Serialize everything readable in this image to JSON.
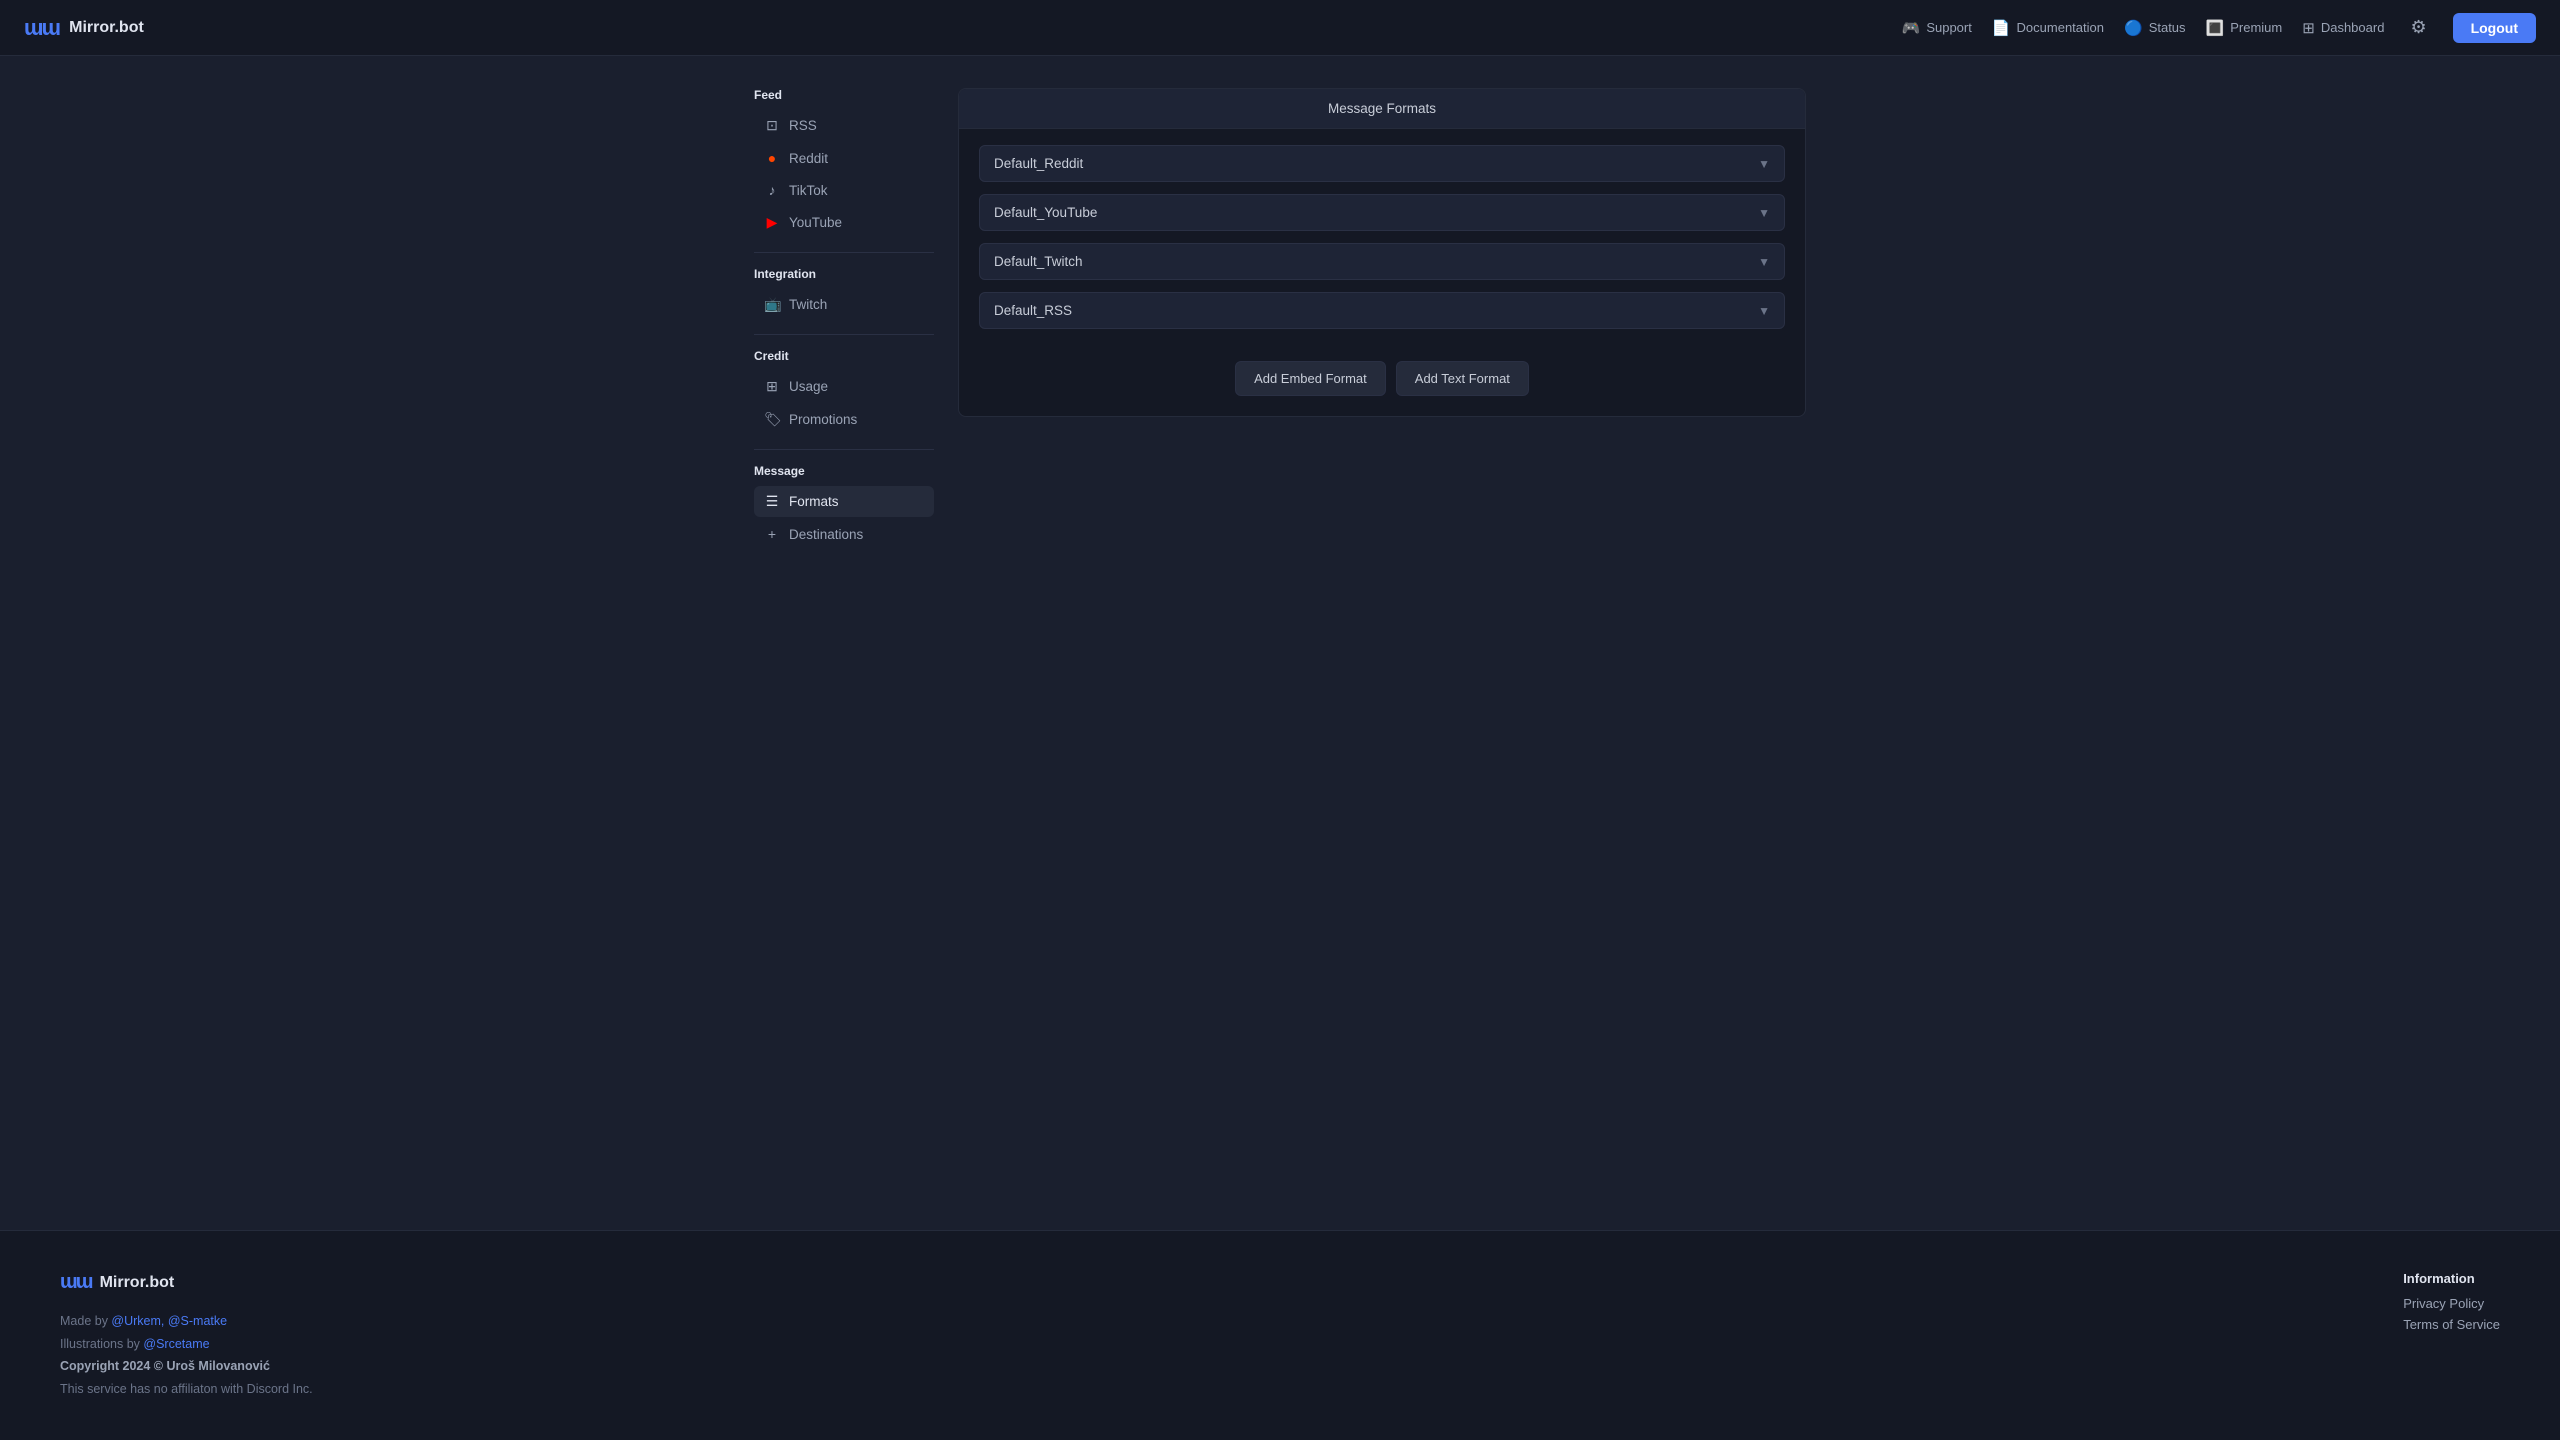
{
  "header": {
    "logo_icon": "ɯɯ",
    "logo_text": "Mirror.bot",
    "nav": [
      {
        "id": "support",
        "label": "Support",
        "icon": "🎮"
      },
      {
        "id": "documentation",
        "label": "Documentation",
        "icon": "📄"
      },
      {
        "id": "status",
        "label": "Status",
        "icon": "🔵"
      },
      {
        "id": "premium",
        "label": "Premium",
        "icon": "🔳"
      },
      {
        "id": "dashboard",
        "label": "Dashboard",
        "icon": "⊞"
      }
    ],
    "logout_label": "Logout"
  },
  "sidebar": {
    "sections": [
      {
        "id": "feed",
        "label": "Feed",
        "items": [
          {
            "id": "rss",
            "label": "RSS",
            "icon": "⊡"
          },
          {
            "id": "reddit",
            "label": "Reddit",
            "icon": "●"
          },
          {
            "id": "tiktok",
            "label": "TikTok",
            "icon": "♪"
          },
          {
            "id": "youtube",
            "label": "YouTube",
            "icon": "▶"
          }
        ]
      },
      {
        "id": "integration",
        "label": "Integration",
        "items": [
          {
            "id": "twitch",
            "label": "Twitch",
            "icon": "📺"
          }
        ]
      },
      {
        "id": "credit",
        "label": "Credit",
        "items": [
          {
            "id": "usage",
            "label": "Usage",
            "icon": "⊞"
          },
          {
            "id": "promotions",
            "label": "Promotions",
            "icon": "🏷"
          }
        ]
      },
      {
        "id": "message",
        "label": "Message",
        "items": [
          {
            "id": "formats",
            "label": "Formats",
            "icon": "☰",
            "active": true
          },
          {
            "id": "destinations",
            "label": "Destinations",
            "icon": "+"
          }
        ]
      }
    ]
  },
  "main": {
    "title": "Message Formats",
    "dropdowns": [
      {
        "id": "reddit",
        "value": "Default_Reddit"
      },
      {
        "id": "youtube",
        "value": "Default_YouTube"
      },
      {
        "id": "twitch",
        "value": "Default_Twitch"
      },
      {
        "id": "rss",
        "value": "Default_RSS"
      }
    ],
    "buttons": [
      {
        "id": "add-embed",
        "label": "Add Embed Format"
      },
      {
        "id": "add-text",
        "label": "Add Text Format"
      }
    ]
  },
  "footer": {
    "logo_icon": "ɯɯ",
    "logo_text": "Mirror.bot",
    "made_by_prefix": "Made by ",
    "made_by_links": "@Urkem, @S-matke",
    "illustrations_prefix": "Illustrations by ",
    "illustrations_link": "@Srcetame",
    "copyright": "Copyright 2024 © Uroš Milovanović",
    "disclaimer": "This service has no affiliaton with Discord Inc.",
    "information_title": "Information",
    "links": [
      {
        "id": "privacy",
        "label": "Privacy Policy"
      },
      {
        "id": "terms",
        "label": "Terms of Service"
      }
    ]
  }
}
